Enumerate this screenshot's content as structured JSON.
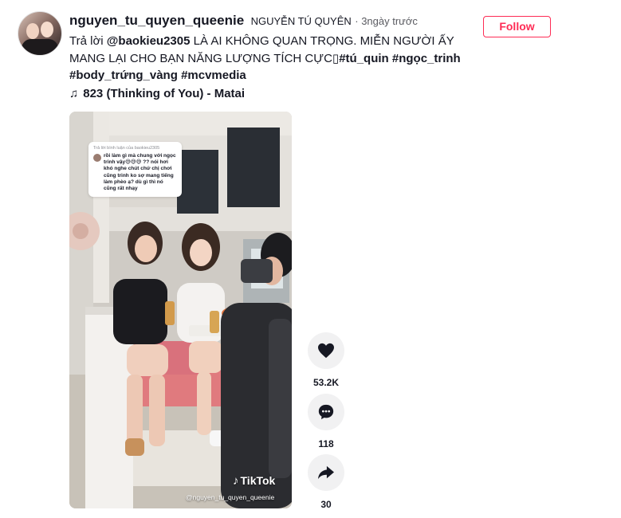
{
  "post": {
    "username": "nguyen_tu_quyen_queenie",
    "nickname": "NGUYỄN TÚ QUYÊN",
    "time": "· 3ngày trước",
    "follow_label": "Follow",
    "caption_prefix": "Trả lời ",
    "caption_mention": "@baokieu2305",
    "caption_text": " LÀ AI KHÔNG QUAN TRỌNG. MIỄN NGƯỜI ẤY MANG LẠI CHO BẠN NĂNG LƯỢNG TÍCH CỰC",
    "tags": [
      "#tú_quin",
      "#ngọc_trinh",
      "#body_trứng_vàng",
      "#mcvmedia"
    ],
    "music_label": "823 (Thinking of You) - Matai"
  },
  "video": {
    "reply_header": "Trả lời bình luận của baokieu2305",
    "reply_comment": "rồi làm gì mà chung với ngọc trinh vậy😅😅😅 ?? nói hơi khó nghe chút chứ chị chơi cũng trinh ko sợ mang tiếng làm phèo ạ? dù gì thì nó cũng rất nhạy",
    "watermark_logo": "TikTok",
    "watermark_handle": "@nguyen_tu_quyen_queenie"
  },
  "actions": {
    "likes": "53.2K",
    "comments": "118",
    "shares": "30"
  },
  "icons": {
    "music": "music-note-icon",
    "like": "heart-icon",
    "comment": "comment-icon",
    "share": "share-arrow-icon"
  },
  "colors": {
    "accent": "#fe2c55",
    "text": "#161823",
    "action_bg": "#f1f1f2"
  }
}
